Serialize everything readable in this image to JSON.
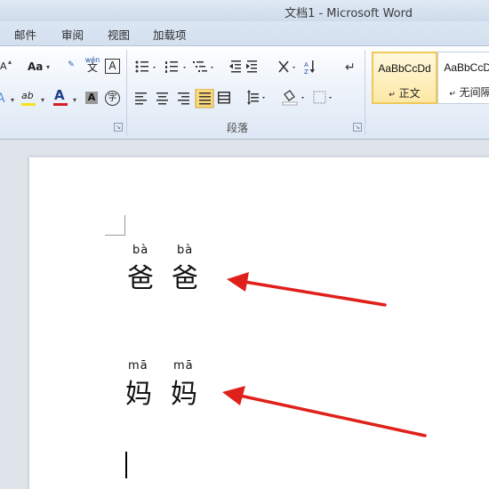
{
  "window": {
    "title": "文档1 - Microsoft Word"
  },
  "tabs": [
    "邮件",
    "审阅",
    "视图",
    "加载项"
  ],
  "ribbon": {
    "font_group": {
      "shrink_font": "A",
      "change_case": "Aa",
      "phonetic_guide": "wén\n文",
      "char_border": "A",
      "text_effect": "A",
      "highlight": "ab",
      "font_color": "A",
      "char_shading": "A",
      "enclose_char": "字"
    },
    "paragraph_group": {
      "label": "段落"
    },
    "styles": [
      {
        "sample": "AaBbCcDd",
        "name": "正文",
        "selected": true
      },
      {
        "sample": "AaBbCcDd",
        "name": "无间隔",
        "selected": false
      }
    ]
  },
  "document": {
    "lines": [
      {
        "pinyin": [
          "bà",
          "bà"
        ],
        "hanzi": [
          "爸",
          "爸"
        ]
      },
      {
        "pinyin": [
          "mā",
          "mā"
        ],
        "hanzi": [
          "妈",
          "妈"
        ]
      }
    ]
  },
  "colors": {
    "arrow": "#e0201a",
    "style_selected": "#f0c85a",
    "font_color_bar": "#d4202b",
    "highlight_bar": "#f4e21a"
  }
}
